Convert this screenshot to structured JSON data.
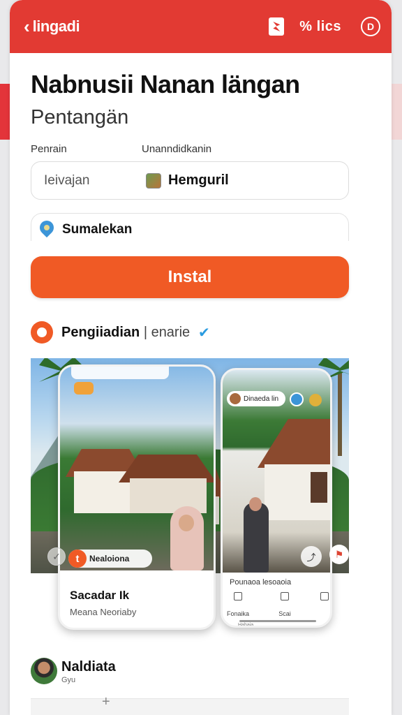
{
  "header": {
    "back_label": "lingadi",
    "code_text": "% lics",
    "power_label": "D"
  },
  "page": {
    "title": "Nabnusii Nanan längan",
    "subtitle": "Pentangän"
  },
  "form": {
    "label_left": "Penrain",
    "label_right": "Unanndidkanin",
    "input_placeholder": "Ieivajan",
    "input_value": "Hemguril",
    "location_label": "Sumalekan"
  },
  "install_button": {
    "label": "Instal"
  },
  "option": {
    "label_bold": "Pengiiadian",
    "label_rest": "| enarie"
  },
  "gallery": {
    "phone1": {
      "chip_badge": "t",
      "chip_text": "Nealoiona",
      "title": "Sacadar Ik",
      "subtitle": "Meana Neoriaby"
    },
    "phone2": {
      "top_chip_text": "Dinaeda lin",
      "caption": "Pounaoa lesoaoia",
      "nav": [
        "Fonaika",
        "Scai",
        ""
      ],
      "bottom_label": "Hahaia"
    }
  },
  "user": {
    "name": "Naldiata",
    "sub": "Gyu"
  },
  "colors": {
    "header_red": "#e23a33",
    "accent_orange": "#f05a25",
    "check_blue": "#2a9be0"
  }
}
